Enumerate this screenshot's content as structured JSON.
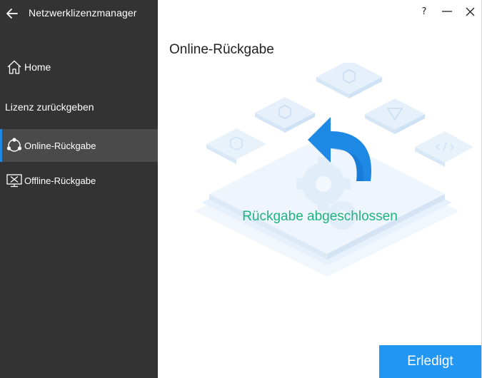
{
  "app": {
    "title": "Netzwerklizenzmanager"
  },
  "sidebar": {
    "home_label": "Home",
    "section_label": "Lizenz zurückgeben",
    "items": [
      {
        "label": "Online-Rückgabe",
        "icon": "network-nodes-icon",
        "active": true
      },
      {
        "label": "Offline-Rückgabe",
        "icon": "monitor-disconnected-icon",
        "active": false
      }
    ]
  },
  "window": {
    "help_label": "?"
  },
  "main": {
    "title": "Online-Rückgabe",
    "status": "Rückgabe abgeschlossen",
    "done_button": "Erledigt"
  },
  "colors": {
    "sidebar_bg": "#333333",
    "active_item_bg": "#4a4a4a",
    "accent_blue": "#2196f3",
    "success_green": "#21b37e"
  }
}
